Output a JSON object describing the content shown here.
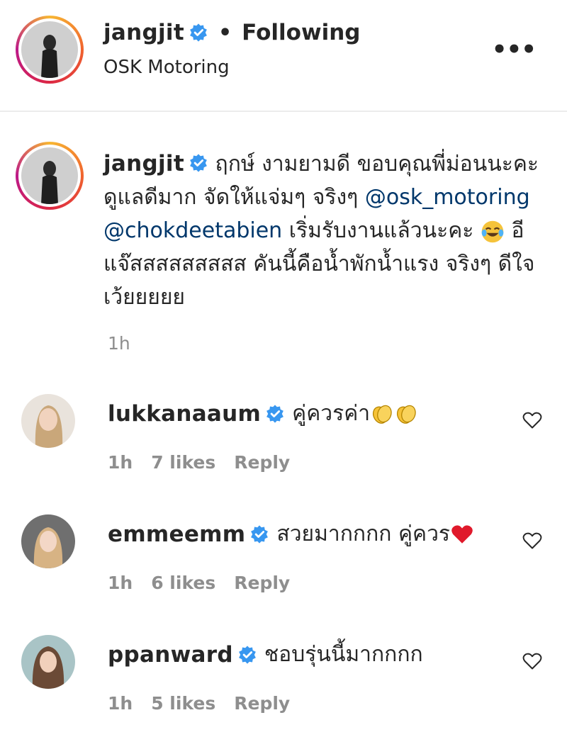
{
  "header": {
    "username": "jangjit",
    "separator": "•",
    "follow_status": "Following",
    "location": "OSK Motoring",
    "more_label": "•••"
  },
  "post": {
    "username": "jangjit",
    "caption_part1": "ฤกษ์ งามยามดี ขอบคุณพี่ม่อนนะคะ ดูแลดีมาก จัดให้แจ่มๆ จริงๆ",
    "mention1": "@osk_motoring",
    "mention2": "@chokdeetabien",
    "caption_part2": "เริ่มรับงานแล้วนะคะ",
    "caption_part3": "อีแจ๊สสสสสสสสส คันนี้คือน้ำพักน้ำแรง จริงๆ ดีใจเว้ยยยยย",
    "time": "1h"
  },
  "comments": [
    {
      "username": "lukkanaaum",
      "text": "คู่ควรค่า",
      "time": "1h",
      "likes": "7 likes",
      "reply": "Reply"
    },
    {
      "username": "emmeemm",
      "text": "สวยมากกกก คู่ควร",
      "time": "1h",
      "likes": "6 likes",
      "reply": "Reply"
    },
    {
      "username": "ppanward",
      "text": "ชอบรุ่นนี้มากกกก",
      "time": "1h",
      "likes": "5 likes",
      "reply": "Reply"
    }
  ],
  "icons": {
    "verified_color": "#3897f0",
    "heart_outline": "heart-icon",
    "clap": "clapping-hands-emoji",
    "laugh": "tears-of-joy-emoji",
    "red_heart": "red-heart-emoji"
  }
}
